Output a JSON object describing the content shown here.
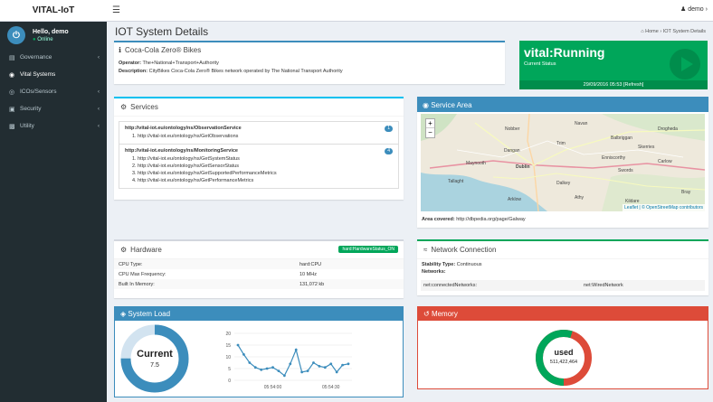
{
  "app": {
    "brand": "VITAL-IoT",
    "user": "demo"
  },
  "sidebar": {
    "greeting": "Hello, demo",
    "status": "Online",
    "items": [
      {
        "label": "Governance",
        "icon": "clipboard-icon"
      },
      {
        "label": "Vital Systems",
        "icon": "dashboard-icon"
      },
      {
        "label": "ICOs/Sensors",
        "icon": "sensor-icon"
      },
      {
        "label": "Security",
        "icon": "lock-icon"
      },
      {
        "label": "Utility",
        "icon": "chart-icon"
      }
    ]
  },
  "header": {
    "title": "IOT System Details",
    "breadcrumb_home": "Home",
    "breadcrumb_current": "IOT System Details"
  },
  "device": {
    "name": "Coca-Cola Zero® Bikes",
    "operator_label": "Operator:",
    "operator": "The+National+Transport+Authority",
    "description_label": "Description:",
    "description": "CityBikes Coca-Cola Zero® Bikes network operated by The National Transport Authority"
  },
  "status": {
    "value": "vital:Running",
    "label": "Current Status",
    "footer": "29/09/2016 05:53 [Refresh]",
    "color": "#00a65a"
  },
  "services": {
    "title": "Services",
    "groups": [
      {
        "name": "http://vital-iot.eu/ontology/ns/ObservationService",
        "count": "1",
        "ops": [
          "1.  http://vital-iot.eu/ontology/ns/GetObservations"
        ]
      },
      {
        "name": "http://vital-iot.eu/ontology/ns/MonitoringService",
        "count": "4",
        "ops": [
          "1.  http://vital-iot.eu/ontology/ns/GetSystemStatus",
          "2.  http://vital-iot.eu/ontology/ns/GetSensorStatus",
          "3.  http://vital-iot.eu/ontology/ns/GetSupportedPerformanceMetrics",
          "4.  http://vital-iot.eu/ontology/ns/GetPerformanceMetrics"
        ]
      }
    ]
  },
  "map": {
    "title": "Service Area",
    "zoom_in": "+",
    "zoom_out": "−",
    "attribution": "Leaflet | © OpenStreetMap contributors",
    "area_label": "Area covered:",
    "area_value": "http://dbpedia.org/page/Galway",
    "places": [
      "Nobber",
      "Balbriggan",
      "Navan",
      "Drogheda",
      "Trim",
      "Skerries",
      "Dangan",
      "Maynooth",
      "Dublin",
      "Swords",
      "Tallaght",
      "Dalkey",
      "Bray",
      "Arklow",
      "Enniscorthy",
      "Carlow",
      "Athy",
      "Kildare"
    ]
  },
  "hardware": {
    "title": "Hardware",
    "badge": "hard:HardwareStatus_ON",
    "rows": [
      {
        "k": "CPU Type:",
        "v": "hard:CPU"
      },
      {
        "k": "CPU Max Frequency:",
        "v": "10 MHz"
      },
      {
        "k": "Built In Memory:",
        "v": "131,072 kb"
      }
    ]
  },
  "network": {
    "title": "Network Connection",
    "stability_label": "Stability Type:",
    "stability": "Continuous",
    "networks_label": "Networks:",
    "row_k": "net:connectedNetworks:",
    "row_v": "net:WiredNetwork"
  },
  "load": {
    "title": "System Load",
    "gauge_label": "Current",
    "gauge_value": "7.5",
    "gauge_fraction": 0.75,
    "y_ticks": [
      "20",
      "15",
      "10",
      "5",
      "0"
    ],
    "x_ticks": [
      "05:54:00",
      "05:54:30"
    ]
  },
  "memory": {
    "title": "Memory",
    "label": "used",
    "value": "511,422,464",
    "used_fraction": 0.55
  },
  "chart_data": {
    "type": "line",
    "title": "",
    "xlabel": "",
    "ylabel": "",
    "ylim": [
      0,
      20
    ],
    "x": [
      "05:53:42",
      "05:53:45",
      "05:53:48",
      "05:53:51",
      "05:53:54",
      "05:53:57",
      "05:54:00",
      "05:54:03",
      "05:54:06",
      "05:54:09",
      "05:54:12",
      "05:54:15",
      "05:54:18",
      "05:54:21",
      "05:54:24",
      "05:54:27",
      "05:54:30",
      "05:54:33",
      "05:54:36",
      "05:54:39"
    ],
    "series": [
      {
        "values": [
          15,
          11,
          7.5,
          5.5,
          4.5,
          5,
          5.5,
          4,
          2,
          7,
          13,
          3.5,
          4,
          7.5,
          6,
          5.5,
          7,
          3.5,
          6.5,
          7
        ]
      }
    ],
    "color": "#3c8dbc"
  }
}
